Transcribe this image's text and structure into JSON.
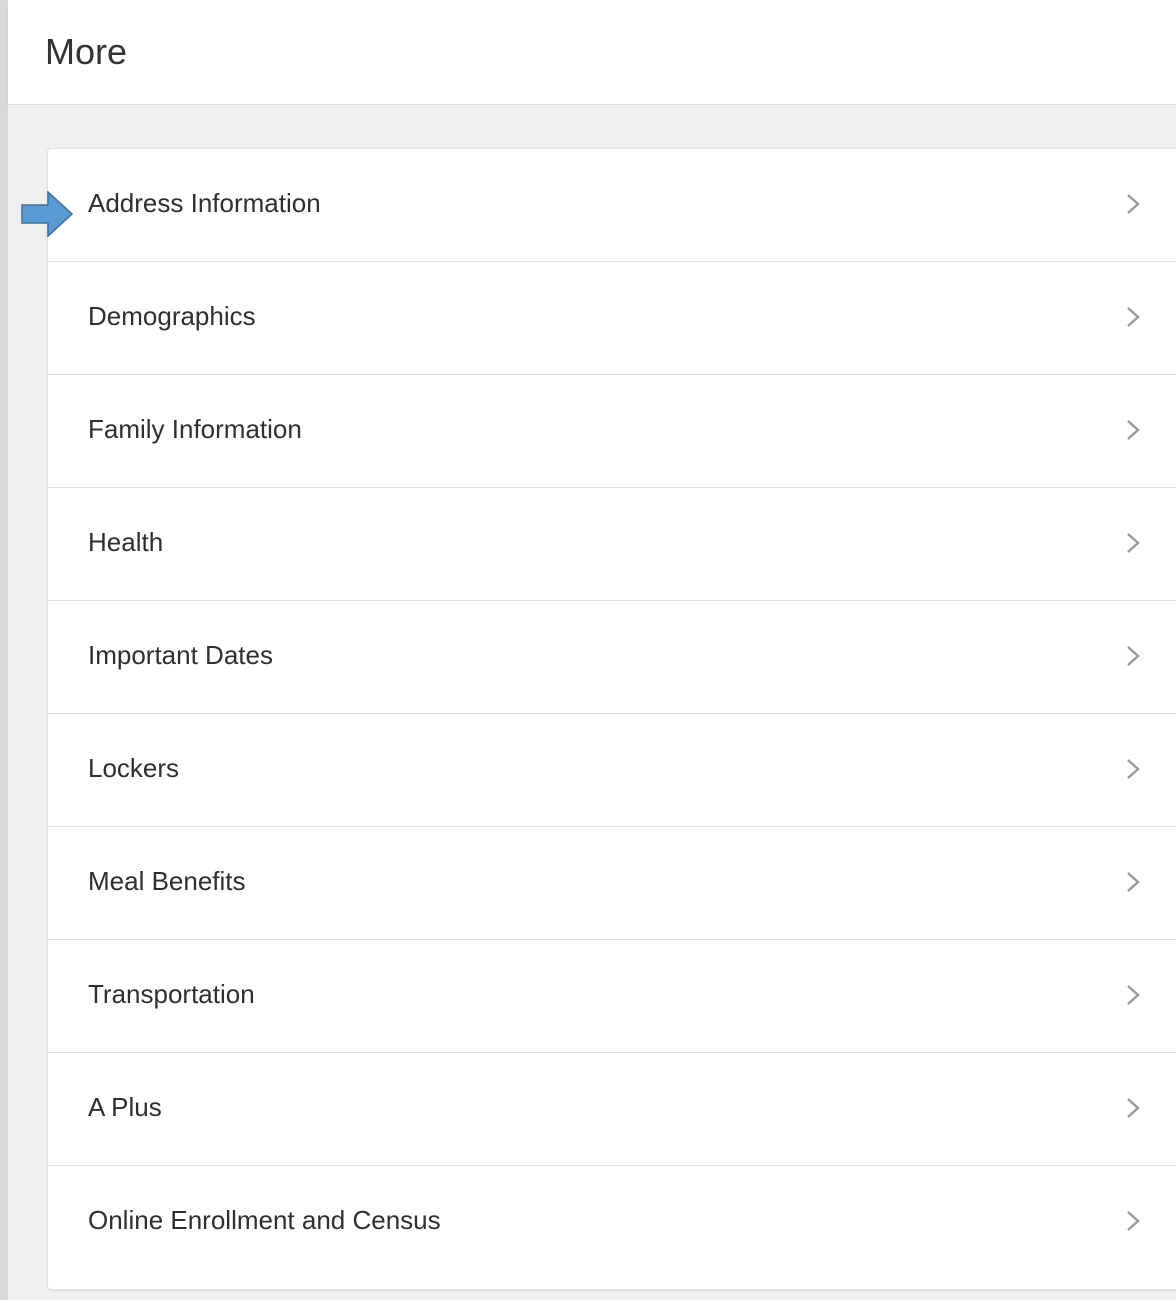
{
  "page": {
    "title": "More"
  },
  "menu": {
    "items": [
      {
        "label": "Address Information",
        "icon": "chevron-right-icon"
      },
      {
        "label": "Demographics",
        "icon": "chevron-right-icon"
      },
      {
        "label": "Family Information",
        "icon": "chevron-right-icon"
      },
      {
        "label": "Health",
        "icon": "chevron-right-icon"
      },
      {
        "label": "Important Dates",
        "icon": "chevron-right-icon"
      },
      {
        "label": "Lockers",
        "icon": "chevron-right-icon"
      },
      {
        "label": "Meal Benefits",
        "icon": "chevron-right-icon"
      },
      {
        "label": "Transportation",
        "icon": "chevron-right-icon"
      },
      {
        "label": "A Plus",
        "icon": "chevron-right-icon"
      },
      {
        "label": "Online Enrollment and Census",
        "icon": "chevron-right-icon"
      }
    ]
  },
  "annotation": {
    "icon": "arrow-right-icon",
    "color": "#5b9bd5"
  },
  "colors": {
    "background": "#efefef",
    "card": "#ffffff",
    "text": "#2f2f2f",
    "chevron": "#9a9a9a"
  }
}
